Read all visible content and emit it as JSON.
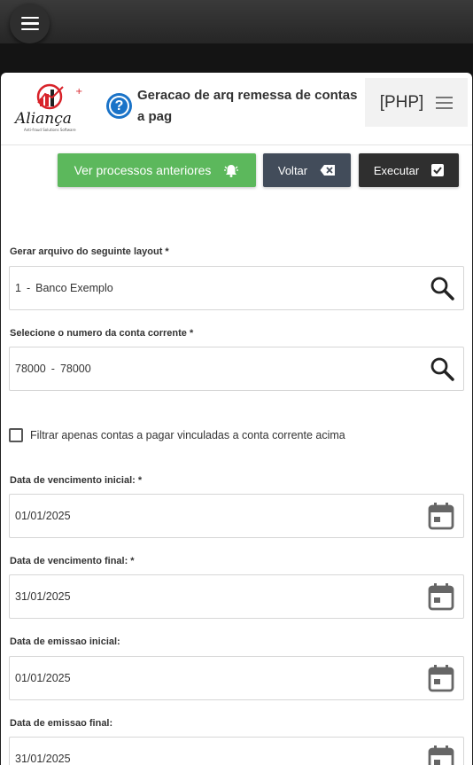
{
  "header": {
    "title": "Geracao de arq remessa de contas a pag",
    "php_label": "[PHP]",
    "logo_text": "Aliança",
    "logo_subtext": "Anti-fraud Solutions Software"
  },
  "toolbar": {
    "history_label": "Ver processos anteriores",
    "back_label": "Voltar",
    "execute_label": "Executar"
  },
  "form": {
    "layout": {
      "label": "Gerar arquivo do seguinte layout *",
      "code": "1",
      "sep": "-",
      "desc": "Banco Exemplo"
    },
    "account": {
      "label": "Selecione o numero da conta corrente *",
      "code": "78000",
      "sep": "-",
      "desc": "78000"
    },
    "filter_checkbox": {
      "label": "Filtrar apenas contas a pagar vinculadas a conta corrente acima",
      "checked": false
    },
    "due_start": {
      "label": "Data de vencimento inicial: *",
      "value": "01/01/2025"
    },
    "due_end": {
      "label": "Data de vencimento final: *",
      "value": "31/01/2025"
    },
    "issue_start": {
      "label": "Data de emissao inicial:",
      "value": "01/01/2025"
    },
    "issue_end": {
      "label": "Data de emissao final:",
      "value": "31/01/2025"
    }
  },
  "colors": {
    "accent_green": "#5cb85c",
    "help_blue": "#1a73c8",
    "logo_red": "#d8232a"
  }
}
